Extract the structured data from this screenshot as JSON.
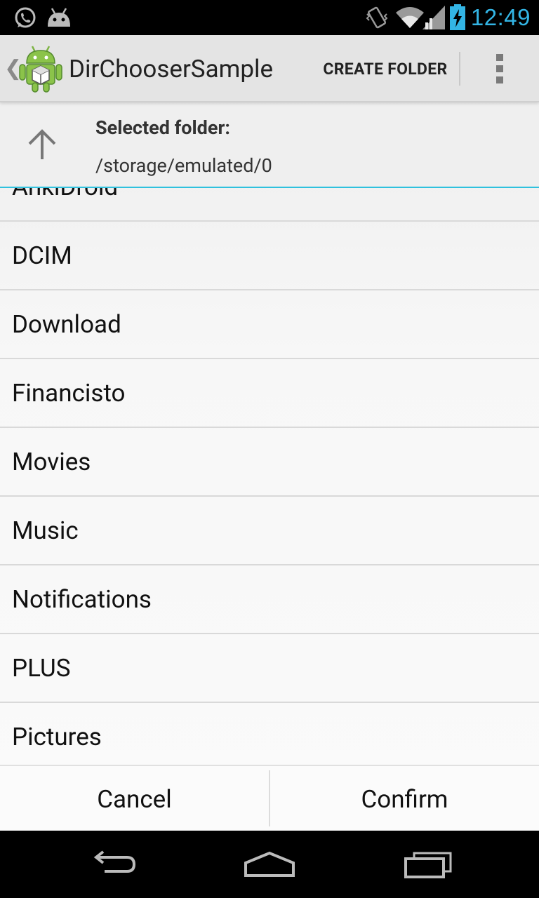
{
  "status_bar": {
    "time": "12:49",
    "left_icons": [
      "whatsapp-icon",
      "android-notification-icon"
    ],
    "right_icons": [
      "vibrate-icon",
      "wifi-icon",
      "signal-icon",
      "battery-charging-icon"
    ],
    "accent_color": "#33b5e5"
  },
  "action_bar": {
    "title": "DirChooserSample",
    "create_folder_label": "CREATE FOLDER",
    "overflow_icon": "overflow-menu-icon"
  },
  "header": {
    "selected_label": "Selected folder:",
    "selected_path": "/storage/emulated/0"
  },
  "folders": [
    {
      "name": "AnkiDroid"
    },
    {
      "name": "DCIM"
    },
    {
      "name": "Download"
    },
    {
      "name": "Financisto"
    },
    {
      "name": "Movies"
    },
    {
      "name": "Music"
    },
    {
      "name": "Notifications"
    },
    {
      "name": "PLUS"
    },
    {
      "name": "Pictures"
    }
  ],
  "buttons": {
    "cancel": "Cancel",
    "confirm": "Confirm"
  },
  "nav_bar": {
    "icons": [
      "back-icon",
      "home-icon",
      "recents-icon"
    ]
  }
}
